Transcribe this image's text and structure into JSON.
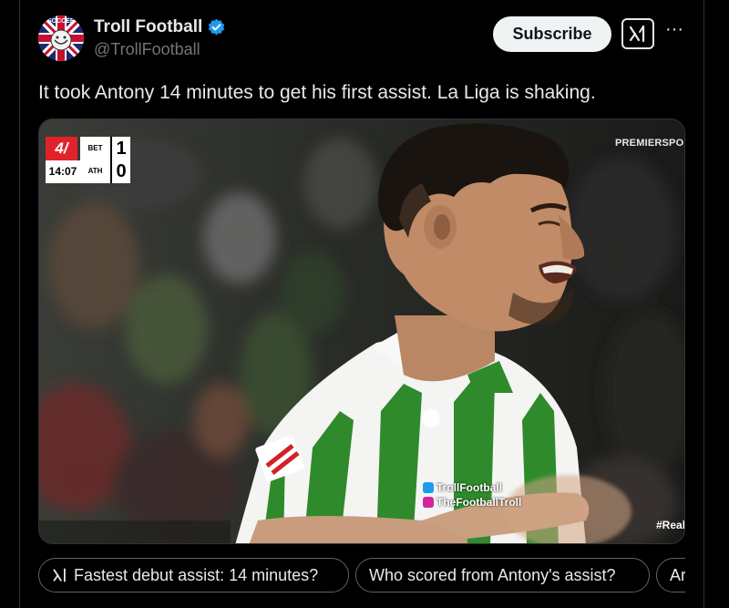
{
  "account": {
    "display_name": "Troll Football",
    "handle": "@TrollFootball",
    "avatar_text": "SOCCER"
  },
  "actions": {
    "subscribe_label": "Subscribe"
  },
  "tweet": {
    "text": "It took Antony 14 minutes to get his first assist. La Liga is shaking."
  },
  "media": {
    "scoreboard": {
      "clock": "14:07",
      "home_team": "BET",
      "away_team": "ATH",
      "home_score": "1",
      "away_score": "0"
    },
    "broadcaster": "PREMIERSPOR",
    "watermark_twitter": "TrollFootball",
    "watermark_instagram": "TheFootballTroll",
    "hashtag": "#Real"
  },
  "suggestions": [
    "Fastest debut assist: 14 minutes?",
    "Who scored from Antony's assist?",
    "Ar"
  ],
  "colors": {
    "background": "#000000",
    "verified": "#1d9bf0",
    "text_primary": "#e7e9ea",
    "text_secondary": "#71767b",
    "jersey_green": "#2f8a2c"
  }
}
